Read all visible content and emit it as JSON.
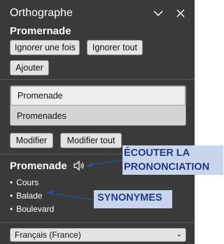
{
  "pane": {
    "title": "Orthographe",
    "misspelled_word": "Promernade",
    "ignore_once_label": "Ignorer une fois",
    "ignore_all_label": "Ignorer tout",
    "add_label": "Ajouter",
    "suggestions": [
      "Promenade",
      "Promenades"
    ],
    "selected_suggestion_index": 0,
    "change_label": "Modifier",
    "change_all_label": "Modifier tout",
    "suggestion_word": "Promenade",
    "synonyms": [
      "Cours",
      "Balade",
      "Boulevard"
    ],
    "bullet": "•",
    "language": "Français (France)",
    "language_chevron": "⌄"
  },
  "annotations": {
    "listen_line1": "ÉCOUTER LA",
    "listen_line2": "PRONONCIATION",
    "synonyms": "SYNONYMES"
  },
  "colors": {
    "pane_background": "#3a3a3a",
    "callout_background": "#c9d5ec",
    "callout_text": "#1f3c88",
    "arrow": "#2a4e9c"
  }
}
